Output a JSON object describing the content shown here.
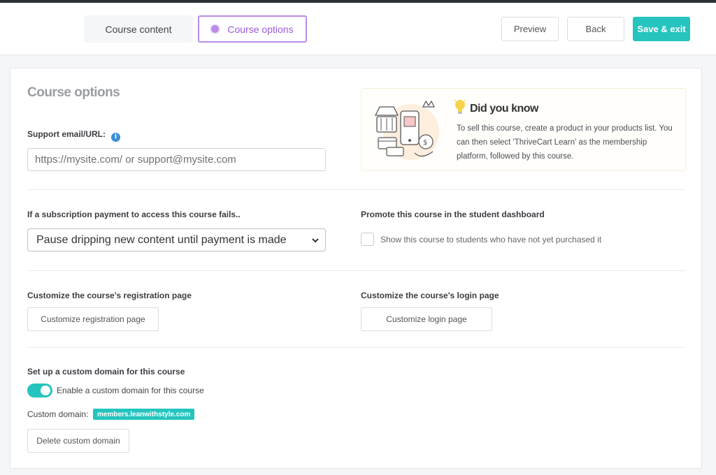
{
  "header": {
    "tabs": [
      {
        "label": "Course content",
        "active": false
      },
      {
        "label": "Course options",
        "active": true
      }
    ],
    "buttons": {
      "preview": "Preview",
      "back": "Back",
      "save_exit": "Save & exit"
    }
  },
  "page": {
    "title": "Course options"
  },
  "support": {
    "label": "Support email/URL:",
    "placeholder": "https://mysite.com/ or support@mysite.com",
    "value": ""
  },
  "did_you_know": {
    "title": "Did you know",
    "body": "To sell this course, create a product in your products list. You can then select 'ThriveCart Learn' as the membership platform, followed by this course."
  },
  "subscription": {
    "label": "If a subscription payment to access this course fails..",
    "selected": "Pause dripping new content until payment is made"
  },
  "promote": {
    "label": "Promote this course in the student dashboard",
    "checkbox_label": "Show this course to students who have not yet purchased it",
    "checked": false
  },
  "registration": {
    "label": "Customize the course's registration page",
    "button": "Customize registration page"
  },
  "login": {
    "label": "Customize the course's login page",
    "button": "Customize login page"
  },
  "custom_domain": {
    "label": "Set up a custom domain for this course",
    "toggle_label": "Enable a custom domain for this course",
    "enabled": true,
    "domain_label": "Custom domain:",
    "domain_value": "members.leanwithstyle.com",
    "delete_button": "Delete custom domain"
  },
  "colors": {
    "accent": "#25c4be",
    "tab_active": "#b98be6",
    "info": "#3b8fd9"
  }
}
